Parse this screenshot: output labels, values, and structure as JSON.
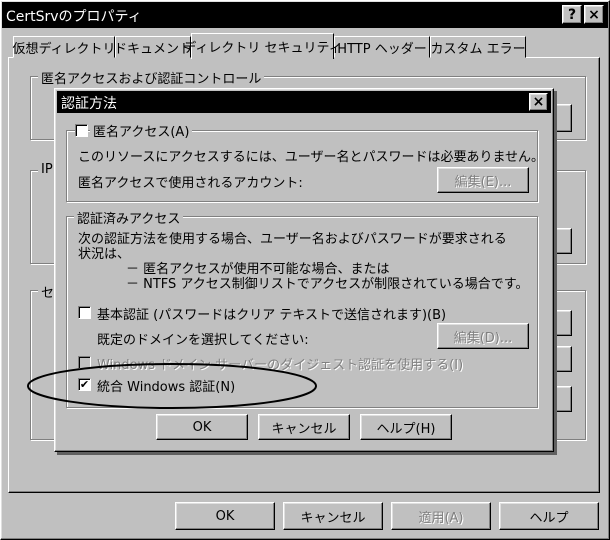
{
  "main_window": {
    "title": "CertSrvのプロパティ",
    "help_btn": "?",
    "close_btn": "×",
    "tabs": [
      "仮想ディレクトリ",
      "ドキュメント",
      "ディレクトリ セキュリティ",
      "HTTP ヘッダー",
      "カスタム エラー"
    ],
    "group1_label": "匿名アクセスおよび認証コントロール",
    "group2_label": "IP",
    "group3_label": "セ",
    "ok": "OK",
    "cancel": "キャンセル",
    "apply": "適用(A)",
    "help": "ヘルプ"
  },
  "dialog": {
    "title": "認証方法",
    "close_btn": "×",
    "anon": {
      "label": "匿名アクセス(A)",
      "desc": "このリソースにアクセスするには、ユーザー名とパスワードは必要ありません。",
      "account_label": "匿名アクセスで使用されるアカウント:",
      "edit_btn": "編集(E)..."
    },
    "auth": {
      "label": "認証済みアクセス",
      "desc1": "次の認証方法を使用する場合、ユーザー名およびパスワードが要求される",
      "desc2": "状況は、",
      "bullet1": "－ 匿名アクセスが使用不可能な場合、または",
      "bullet2": "－ NTFS アクセス制御リストでアクセスが制限されている場合です。",
      "basic_label": "基本認証 (パスワードはクリア テキストで送信されます)(B)",
      "domain_label": "既定のドメインを選択してください:",
      "edit_btn": "編集(D)...",
      "digest_label": "Windows ドメイン サーバーのダイジェスト認証を使用する(I)",
      "integrated_label": "統合 Windows 認証(N)",
      "integrated_checked": "✔"
    },
    "ok": "OK",
    "cancel": "キャンセル",
    "help": "ヘルプ(H)"
  }
}
